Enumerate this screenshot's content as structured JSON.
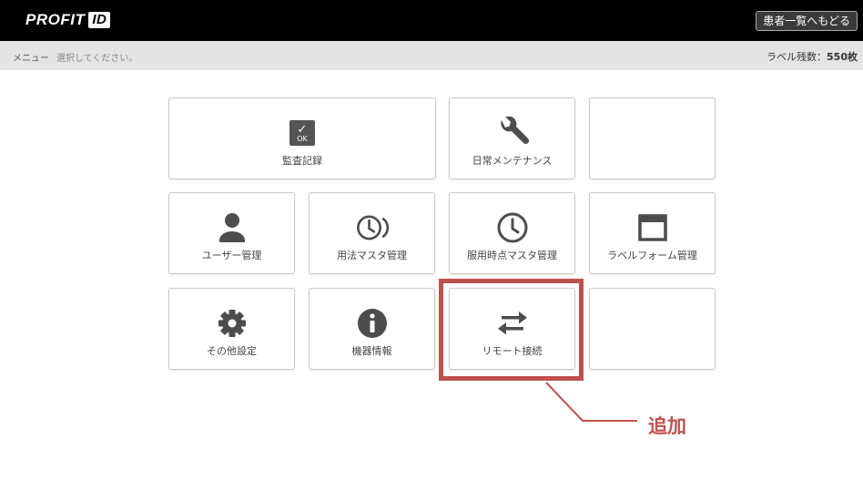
{
  "header": {
    "logo_text": "PROFIT",
    "logo_badge": "ID",
    "back_button": "患者一覧へもどる"
  },
  "subheader": {
    "menu_label": "メニュー",
    "hint": "選択してください。",
    "label_count_prefix": "ラベル残数：",
    "label_count_value": "550枚"
  },
  "tiles": {
    "audit": {
      "label": "監査記録",
      "icon": "ok-check-icon",
      "icon_text": "OK"
    },
    "maintenance": {
      "label": "日常メンテナンス",
      "icon": "wrench-icon"
    },
    "user": {
      "label": "ユーザー管理",
      "icon": "user-icon"
    },
    "usage_master": {
      "label": "用法マスタ管理",
      "icon": "clock-waves-icon"
    },
    "dose_time_master": {
      "label": "服用時点マスタ管理",
      "icon": "clock-icon"
    },
    "label_form": {
      "label": "ラベルフォーム管理",
      "icon": "window-icon"
    },
    "other_settings": {
      "label": "その他設定",
      "icon": "gear-icon"
    },
    "device_info": {
      "label": "機器情報",
      "icon": "info-icon"
    },
    "remote": {
      "label": "リモート接続",
      "icon": "swap-arrows-icon"
    }
  },
  "annotation": {
    "text": "追加",
    "color": "#c0504d"
  },
  "colors": {
    "topbar": "#000000",
    "subbar": "#e4e4e4",
    "icon": "#4d4d4d"
  }
}
